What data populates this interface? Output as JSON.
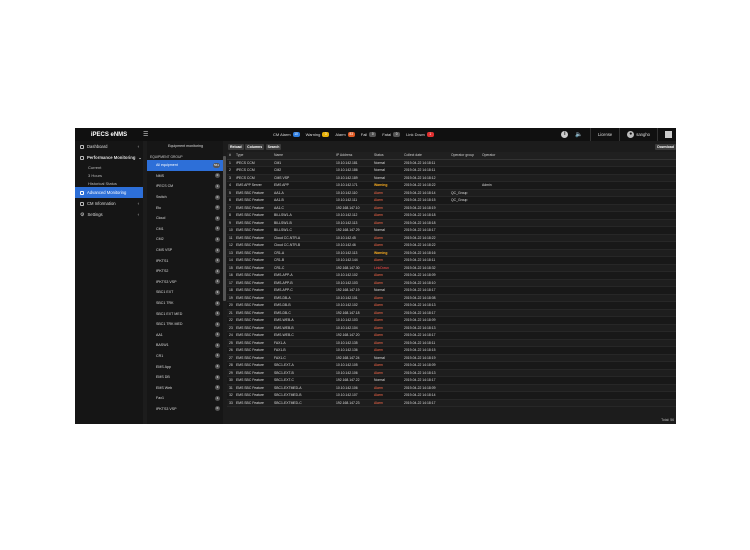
{
  "app": {
    "title": "iPECS eNMS"
  },
  "alarms": [
    {
      "label": "CM Alarm",
      "count": "10",
      "color": "#2d7de0"
    },
    {
      "label": "Warning",
      "count": "3",
      "color": "#e7b10a"
    },
    {
      "label": "Alarm",
      "count": "83",
      "color": "#e05a24"
    },
    {
      "label": "Fail",
      "count": "0",
      "color": "#555555"
    },
    {
      "label": "Fatal",
      "count": "0",
      "color": "#555555"
    },
    {
      "label": "Link Down",
      "count": "1",
      "color": "#e03030"
    }
  ],
  "topbar": {
    "license": "License",
    "user": "sangho"
  },
  "sidebar": {
    "dashboard": "Dashboard",
    "performance": "Performance Monitoring",
    "sub": [
      "Current",
      "3 Hours",
      "Historical Status"
    ],
    "advanced": "Advanced Monitoring",
    "cm": "CM Information",
    "settings": "Settings"
  },
  "equipment": {
    "header": "Equipment monitoring",
    "group_label": "EQUIPMENT GROUP",
    "items": [
      {
        "label": "All equipment",
        "count": "561"
      },
      {
        "label": "NMS",
        "count": "0"
      },
      {
        "label": "iPECS CM",
        "count": "1"
      },
      {
        "label": "Switch",
        "count": "0"
      },
      {
        "label": "Etc",
        "count": "0"
      },
      {
        "label": "Cloud",
        "count": "3"
      },
      {
        "label": "CM1",
        "count": "1"
      },
      {
        "label": "CM2",
        "count": "1"
      },
      {
        "label": "CMS VSP",
        "count": "1"
      },
      {
        "label": "IPKTS1",
        "count": "1"
      },
      {
        "label": "IPKTS2",
        "count": "1"
      },
      {
        "label": "IPKTS3 VSP",
        "count": "1"
      },
      {
        "label": "SBC1 EXT",
        "count": "3"
      },
      {
        "label": "SBC1 TRK",
        "count": "2"
      },
      {
        "label": "SBC1 EXT MED",
        "count": "1"
      },
      {
        "label": "SBC1 TRK MED",
        "count": "1"
      },
      {
        "label": "AA1",
        "count": "1"
      },
      {
        "label": "BASW1",
        "count": "1"
      },
      {
        "label": "CR1",
        "count": "1"
      },
      {
        "label": "EMS App",
        "count": "4"
      },
      {
        "label": "EMS DB",
        "count": "3"
      },
      {
        "label": "EMS Web",
        "count": "3"
      },
      {
        "label": "Fax1",
        "count": "1"
      },
      {
        "label": "IPKTS3 VSP",
        "count": "0"
      }
    ]
  },
  "toolbar": {
    "reload": "Reload",
    "columns": "Columns",
    "search": "Search",
    "download": "Download"
  },
  "table": {
    "headers": [
      "#",
      "Type",
      "Name",
      "IP Address",
      "Status",
      "Collect date",
      "Operator group",
      "Operator"
    ],
    "rows": [
      [
        "1",
        "iPECS CCM",
        "CM1",
        "10.10.142.181",
        "Normal",
        "2019-04-22 14:18:11",
        "",
        ""
      ],
      [
        "2",
        "iPECS CCM",
        "CM2",
        "10.10.142.186",
        "Normal",
        "2019-04-22 14:18:11",
        "",
        ""
      ],
      [
        "3",
        "iPECS CCM",
        "CMS VSP",
        "10.10.142.189",
        "Normal",
        "2019-04-22 14:18:12",
        "",
        ""
      ],
      [
        "4",
        "EMS APP Server",
        "EMS APP",
        "10.10.142.171",
        "Warning",
        "2019-04-22 14:18:22",
        "",
        "Admin"
      ],
      [
        "5",
        "EMS SBC Feature",
        "AA1-A",
        "10.10.142.110",
        "Alarm",
        "2019-04-22 14:18:14",
        "QC_Group",
        ""
      ],
      [
        "6",
        "EMS SBC Feature",
        "AA1-B",
        "10.10.142.111",
        "Alarm",
        "2019-04-22 14:18:15",
        "QC_Group",
        ""
      ],
      [
        "7",
        "EMS SBC Feature",
        "AA1-C",
        "192.168.147.10",
        "Alarm",
        "2019-04-22 14:18:19",
        "",
        ""
      ],
      [
        "8",
        "EMS SBC Feature",
        "BILLSW1-A",
        "10.10.142.112",
        "Alarm",
        "2019-04-22 14:18:18",
        "",
        ""
      ],
      [
        "9",
        "EMS SBC Feature",
        "BILLSW1-B",
        "10.10.142.113",
        "Alarm",
        "2019-04-22 14:18:18",
        "",
        ""
      ],
      [
        "10",
        "EMS SBC Feature",
        "BILLSW1-C",
        "192.168.147.29",
        "Normal",
        "2019-04-22 14:18:17",
        "",
        ""
      ],
      [
        "11",
        "EMS SBC Feature",
        "Cloud CC-NTR-A",
        "10.10.142.45",
        "Alarm",
        "2019-04-22 14:18:22",
        "",
        ""
      ],
      [
        "12",
        "EMS SBC Feature",
        "Cloud CC-NTR-B",
        "10.10.142.46",
        "Alarm",
        "2019-04-22 14:18:22",
        "",
        ""
      ],
      [
        "13",
        "EMS SBC Feature",
        "CR1-A",
        "10.10.142.113",
        "Warning",
        "2019-04-22 14:18:16",
        "",
        ""
      ],
      [
        "14",
        "EMS SBC Feature",
        "CR1-B",
        "10.10.142.144",
        "Alarm",
        "2019-04-22 14:18:11",
        "",
        ""
      ],
      [
        "15",
        "EMS SBC Feature",
        "CR1-C",
        "192.168.147.30",
        "LinkDown",
        "2019-04-22 14:18:32",
        "",
        ""
      ],
      [
        "16",
        "EMS SBC Feature",
        "EMS-APP-A",
        "10.10.142.102",
        "Alarm",
        "2019-04-22 14:18:09",
        "",
        ""
      ],
      [
        "17",
        "EMS SBC Feature",
        "EMS-APP-B",
        "10.10.142.103",
        "Alarm",
        "2019-04-22 14:18:10",
        "",
        ""
      ],
      [
        "18",
        "EMS SBC Feature",
        "EMS-APP-C",
        "192.168.147.19",
        "Normal",
        "2019-04-22 14:18:17",
        "",
        ""
      ],
      [
        "19",
        "EMS SBC Feature",
        "EMS-DB-A",
        "10.10.142.101",
        "Alarm",
        "2019-04-22 14:18:08",
        "",
        ""
      ],
      [
        "20",
        "EMS SBC Feature",
        "EMS-DB-B",
        "10.10.142.102",
        "Alarm",
        "2019-04-22 14:18:13",
        "",
        ""
      ],
      [
        "21",
        "EMS SBC Feature",
        "EMS-DB-C",
        "192.168.147.18",
        "Alarm",
        "2019-04-22 14:18:17",
        "",
        ""
      ],
      [
        "22",
        "EMS SBC Feature",
        "EMS-WEB-A",
        "10.10.142.103",
        "Alarm",
        "2019-04-22 14:18:09",
        "",
        ""
      ],
      [
        "23",
        "EMS SBC Feature",
        "EMS-WEB-B",
        "10.10.142.104",
        "Alarm",
        "2019-04-22 14:18:13",
        "",
        ""
      ],
      [
        "24",
        "EMS SBC Feature",
        "EMS-WEB-C",
        "192.168.147.20",
        "Alarm",
        "2019-04-22 14:18:17",
        "",
        ""
      ],
      [
        "25",
        "EMS SBC Feature",
        "FAX1-A",
        "10.10.142.135",
        "Alarm",
        "2019-04-22 14:18:11",
        "",
        ""
      ],
      [
        "26",
        "EMS SBC Feature",
        "FAX1-B",
        "10.10.142.136",
        "Alarm",
        "2019-04-22 14:18:15",
        "",
        ""
      ],
      [
        "27",
        "EMS SBC Feature",
        "FAX1-C",
        "192.168.147.24",
        "Normal",
        "2019-04-22 14:18:19",
        "",
        ""
      ],
      [
        "28",
        "EMS SBC Feature",
        "SBC1-EXT-A",
        "10.10.142.105",
        "Alarm",
        "2019-04-22 14:18:09",
        "",
        ""
      ],
      [
        "29",
        "EMS SBC Feature",
        "SBC1-EXT-B",
        "10.10.142.106",
        "Alarm",
        "2019-04-22 14:18:13",
        "",
        ""
      ],
      [
        "30",
        "EMS SBC Feature",
        "SBC1-EXT-C",
        "192.168.147.22",
        "Normal",
        "2019-04-22 14:18:17",
        "",
        ""
      ],
      [
        "31",
        "EMS SBC Feature",
        "SBC1-EXTMED-A",
        "10.10.142.106",
        "Alarm",
        "2019-04-22 14:18:09",
        "",
        ""
      ],
      [
        "32",
        "EMS SBC Feature",
        "SBC1-EXTMED-B",
        "10.10.142.107",
        "Alarm",
        "2019-04-22 14:18:14",
        "",
        ""
      ],
      [
        "33",
        "EMS SBC Feature",
        "SBC1-EXTMED-C",
        "192.168.147.23",
        "Alarm",
        "2019-04-22 14:18:17",
        "",
        ""
      ]
    ],
    "total": "Total: 56"
  }
}
